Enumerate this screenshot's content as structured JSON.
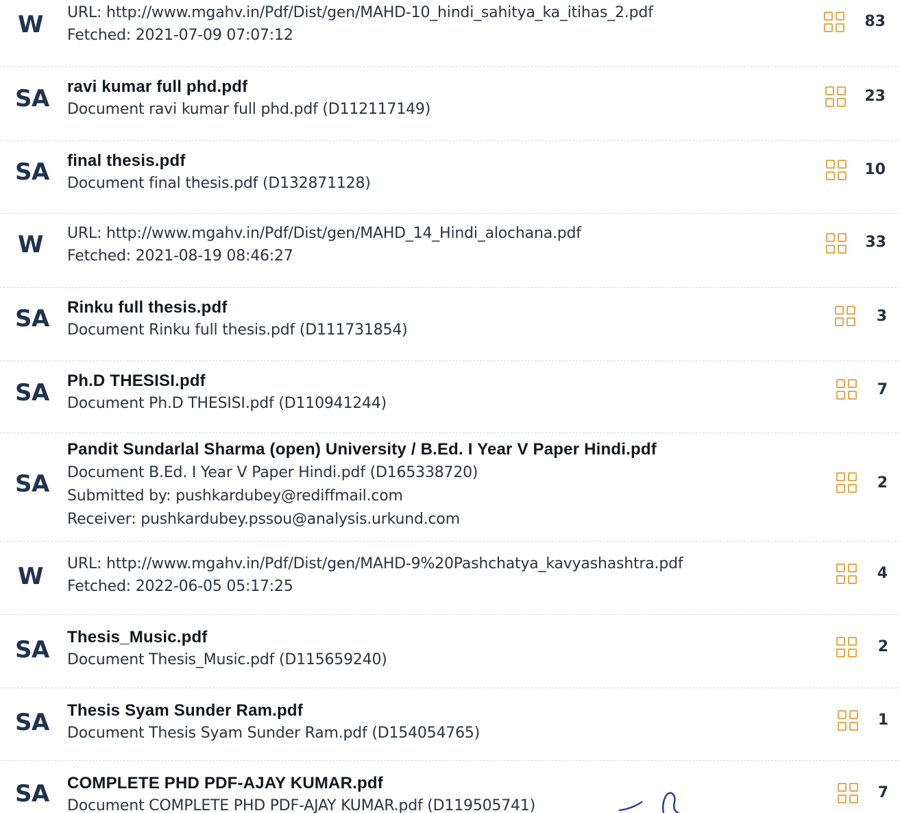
{
  "sources": [
    {
      "type": "W",
      "lines": [
        "URL: http://www.mgahv.in/Pdf/Dist/gen/MAHD-10_hindi_sahitya_ka_itihas_2.pdf",
        "Fetched: 2021-07-09 07:07:12"
      ],
      "title_line": false,
      "count": "83"
    },
    {
      "type": "SA",
      "lines": [
        "ravi kumar full phd.pdf",
        "Document ravi kumar full phd.pdf (D112117149)"
      ],
      "title_line": true,
      "count": "23"
    },
    {
      "type": "SA",
      "lines": [
        "final thesis.pdf",
        "Document final thesis.pdf (D132871128)"
      ],
      "title_line": true,
      "count": "10"
    },
    {
      "type": "W",
      "lines": [
        "URL: http://www.mgahv.in/Pdf/Dist/gen/MAHD_14_Hindi_alochana.pdf",
        "Fetched: 2021-08-19 08:46:27"
      ],
      "title_line": false,
      "count": "33"
    },
    {
      "type": "SA",
      "lines": [
        "Rinku full thesis.pdf",
        "Document Rinku full thesis.pdf (D111731854)"
      ],
      "title_line": true,
      "count": "3"
    },
    {
      "type": "SA",
      "lines": [
        "Ph.D THESISI.pdf",
        "Document Ph.D THESISI.pdf (D110941244)"
      ],
      "title_line": true,
      "count": "7"
    },
    {
      "type": "SA",
      "lines": [
        "Pandit Sundarlal Sharma (open) University / B.Ed. I Year V Paper Hindi.pdf",
        "Document B.Ed. I Year V Paper Hindi.pdf (D165338720)",
        "Submitted by: pushkardubey@rediffmail.com",
        "Receiver: pushkardubey.pssou@analysis.urkund.com"
      ],
      "title_line": true,
      "count": "2"
    },
    {
      "type": "W",
      "lines": [
        "URL: http://www.mgahv.in/Pdf/Dist/gen/MAHD-9%20Pashchatya_kavyashashtra.pdf",
        "Fetched: 2022-06-05 05:17:25"
      ],
      "title_line": false,
      "count": "4"
    },
    {
      "type": "SA",
      "lines": [
        "Thesis_Music.pdf",
        "Document Thesis_Music.pdf (D115659240)"
      ],
      "title_line": true,
      "count": "2"
    },
    {
      "type": "SA",
      "lines": [
        "Thesis Syam Sunder Ram.pdf",
        "Document Thesis Syam Sunder Ram.pdf (D154054765)"
      ],
      "title_line": true,
      "count": "1"
    },
    {
      "type": "SA",
      "lines": [
        "COMPLETE PHD PDF-AJAY KUMAR.pdf",
        "Document COMPLETE PHD PDF-AJAY KUMAR.pdf (D119505741)"
      ],
      "title_line": true,
      "count": "7"
    }
  ],
  "colors": {
    "badge": "#1f3350",
    "match_icon": "#e8a84a",
    "count": "#263140",
    "signature_ink": "#2a3fa0"
  },
  "icons": {
    "match": "grid-2x2-icon",
    "signature": "handwritten-signature"
  }
}
